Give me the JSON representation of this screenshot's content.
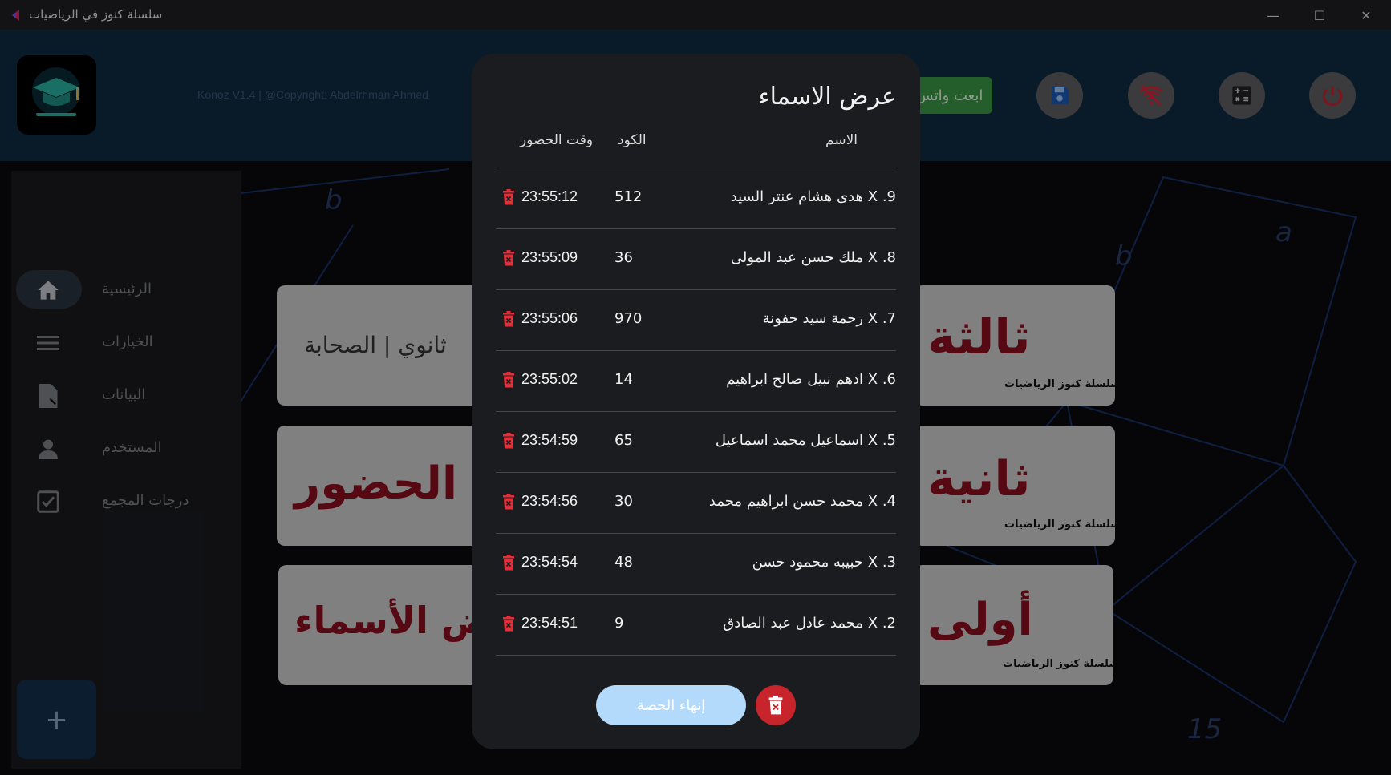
{
  "window": {
    "title": "سلسلة كنوز في الرياضيات",
    "minimize": "—",
    "maximize": "☐",
    "close": "✕"
  },
  "header": {
    "copyright": "Konoz V1.4 | @Copyright: Abdelrhman Ahmed",
    "send_label": "ابعت واتس",
    "icons": [
      "save-icon",
      "wifi-off-icon",
      "calculator-icon",
      "power-icon"
    ]
  },
  "sidebar": {
    "items": [
      {
        "label": "الرئيسية",
        "icon": "home-icon"
      },
      {
        "label": "الخيارات",
        "icon": "menu-icon"
      },
      {
        "label": "البيانات",
        "icon": "data-file-icon"
      },
      {
        "label": "المستخدم",
        "icon": "user-icon"
      },
      {
        "label": "درجات المجمع",
        "icon": "checkbox-icon"
      }
    ],
    "add_label": "+"
  },
  "cards": {
    "left": [
      "ثانوي | الصحابة",
      "الحضور",
      "عرض الأسماء"
    ],
    "right": [
      "ثالثة",
      "ثانية",
      "أولى"
    ],
    "brand": "سلسلة كنوز الرياضيات"
  },
  "dialog": {
    "title": "عرض الاسماء",
    "headers": {
      "name": "الاسم",
      "code": "الكود",
      "time": "وقت الحضور"
    },
    "rows": [
      {
        "name": "9. X هدى هشام عنتر السيد",
        "code": "512",
        "time": "23:55:12"
      },
      {
        "name": "8. X ملك حسن عبد المولى",
        "code": "36",
        "time": "23:55:09"
      },
      {
        "name": "7. X رحمة سيد حفونة",
        "code": "970",
        "time": "23:55:06"
      },
      {
        "name": "6. X ادهم نبيل صالح ابراهيم",
        "code": "14",
        "time": "23:55:02"
      },
      {
        "name": "5. X اسماعيل محمد اسماعيل",
        "code": "65",
        "time": "23:54:59"
      },
      {
        "name": "4. X محمد حسن ابراهيم محمد",
        "code": "30",
        "time": "23:54:56"
      },
      {
        "name": "3. X حبيبه محمود حسن",
        "code": "48",
        "time": "23:54:54"
      },
      {
        "name": "2. X محمد عادل عبد الصادق",
        "code": "9",
        "time": "23:54:51"
      }
    ],
    "end_label": "إنهاء الحصة"
  },
  "colors": {
    "header_bg": "#0f2a43",
    "dialog_bg": "#1b1c1f",
    "delete_red": "#c8242c",
    "send_green": "#3b9a46",
    "end_button": "#b3d9fb"
  }
}
